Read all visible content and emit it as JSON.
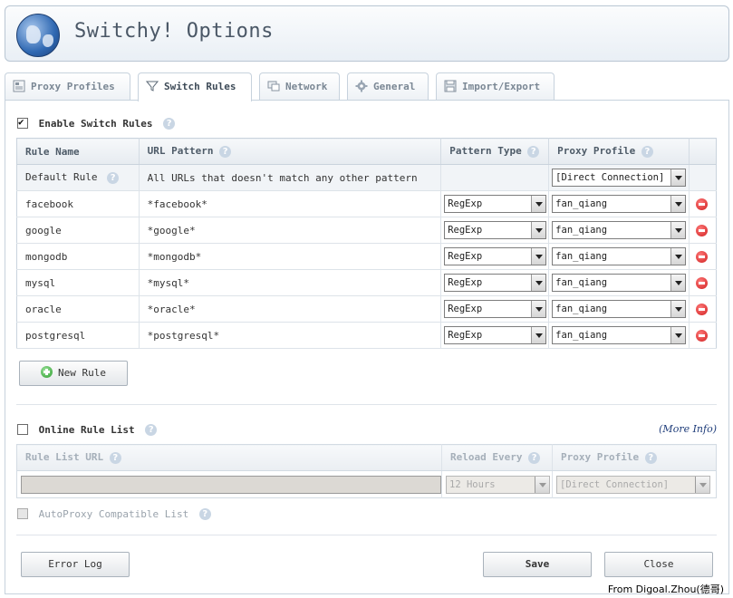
{
  "app": {
    "title": "Switchy! Options"
  },
  "tabs": [
    {
      "label": "Proxy Profiles",
      "icon": "proxy-profiles-icon"
    },
    {
      "label": "Switch Rules",
      "icon": "filter-icon"
    },
    {
      "label": "Network",
      "icon": "network-icon"
    },
    {
      "label": "General",
      "icon": "gear-icon"
    },
    {
      "label": "Import/Export",
      "icon": "floppy-icon"
    }
  ],
  "switch_rules": {
    "enable_label": "Enable Switch Rules",
    "enabled": true,
    "columns": [
      "Rule Name",
      "URL Pattern",
      "Pattern Type",
      "Proxy Profile"
    ],
    "default_rule": {
      "name": "Default Rule",
      "pattern": "All URLs that doesn't match any other pattern",
      "profile": "[Direct Connection]"
    },
    "rows": [
      {
        "name": "facebook",
        "pattern": "*facebook*",
        "type": "RegExp",
        "profile": "fan_qiang"
      },
      {
        "name": "google",
        "pattern": "*google*",
        "type": "RegExp",
        "profile": "fan_qiang"
      },
      {
        "name": "mongodb",
        "pattern": "*mongodb*",
        "type": "RegExp",
        "profile": "fan_qiang"
      },
      {
        "name": "mysql",
        "pattern": "*mysql*",
        "type": "RegExp",
        "profile": "fan_qiang"
      },
      {
        "name": "oracle",
        "pattern": "*oracle*",
        "type": "RegExp",
        "profile": "fan_qiang"
      },
      {
        "name": "postgresql",
        "pattern": "*postgresql*",
        "type": "RegExp",
        "profile": "fan_qiang"
      }
    ],
    "new_rule_label": "New Rule"
  },
  "online_list": {
    "label": "Online Rule List",
    "enabled": false,
    "more_info": "(More Info)",
    "columns": [
      "Rule List URL",
      "Reload Every",
      "Proxy Profile"
    ],
    "url_value": "",
    "reload_value": "12 Hours",
    "profile_value": "[Direct Connection]",
    "autoproxy_label": "AutoProxy Compatible List"
  },
  "footer": {
    "error_log_label": "Error Log",
    "save_label": "Save",
    "close_label": "Close",
    "credit": "From Digoal.Zhou(德哥)"
  },
  "colors": {
    "accent": "#3d6fb0",
    "delete": "#d01f1f",
    "add": "#2d9d2d"
  }
}
